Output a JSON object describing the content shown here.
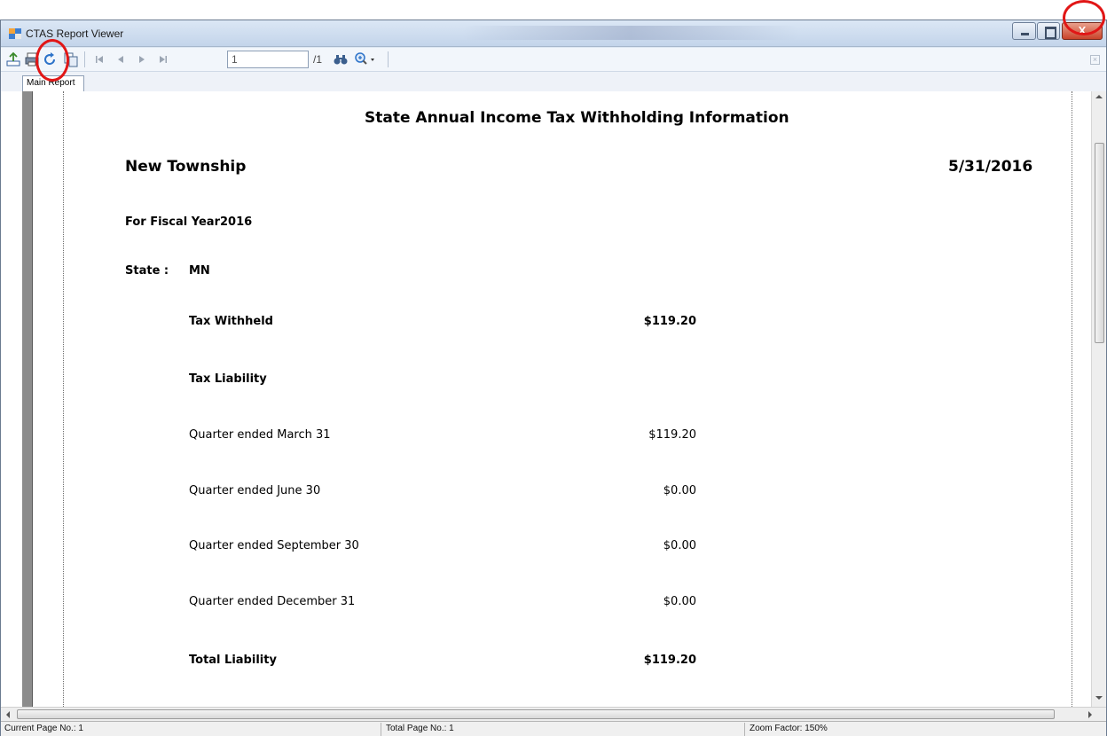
{
  "window": {
    "title": "CTAS Report Viewer",
    "close_label": "X",
    "accent_color": "#e11616"
  },
  "toolbar": {
    "current_page": "1",
    "total_pages": "/1",
    "icons": [
      "export-icon",
      "print-icon",
      "refresh-icon",
      "copy-icon",
      "first-page-icon",
      "previous-page-icon",
      "next-page-icon",
      "last-page-icon",
      "find-icon",
      "zoom-icon"
    ]
  },
  "tabs": [
    {
      "label": "Main Report"
    }
  ],
  "report": {
    "title": "State Annual Income Tax Withholding Information",
    "township": "New Township",
    "date": "5/31/2016",
    "fiscal_year_label": "For Fiscal Year",
    "fiscal_year": "2016",
    "state_label": "State :",
    "state": "MN",
    "rows": [
      {
        "label": "Tax Withheld",
        "value": "$119.20",
        "bold": true
      },
      {
        "label": "Tax Liability",
        "value": "",
        "bold": true
      },
      {
        "label": "Quarter ended March 31",
        "value": "$119.20",
        "bold": false
      },
      {
        "label": "Quarter ended June 30",
        "value": "$0.00",
        "bold": false
      },
      {
        "label": "Quarter ended September 30",
        "value": "$0.00",
        "bold": false
      },
      {
        "label": "Quarter ended December 31",
        "value": "$0.00",
        "bold": false
      },
      {
        "label": "Total Liability",
        "value": "$119.20",
        "bold": true
      }
    ]
  },
  "statusbar": {
    "current_page": "Current Page No.: 1",
    "total_pages": "Total Page No.: 1",
    "zoom": "Zoom Factor: 150%"
  }
}
